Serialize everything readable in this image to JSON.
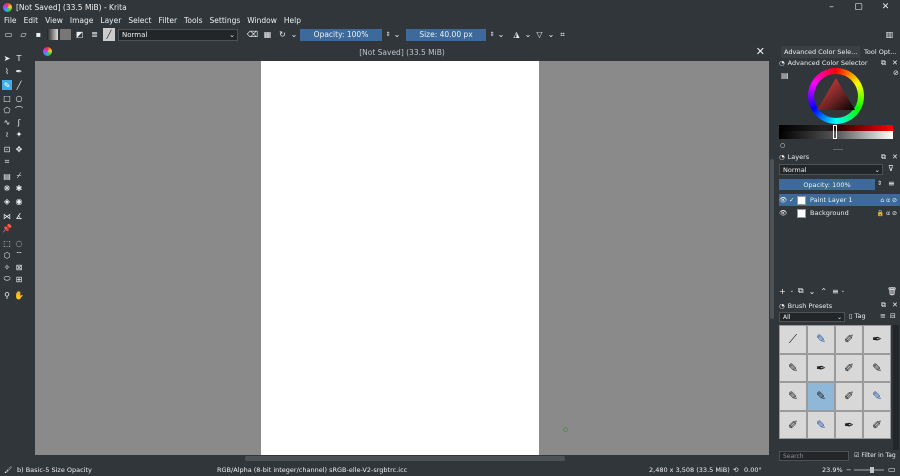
{
  "window": {
    "title": "[Not Saved]  (33.5 MiB)  - Krita",
    "minimize": "–",
    "maximize": "▢",
    "close": "✕"
  },
  "menu": [
    "File",
    "Edit",
    "View",
    "Image",
    "Layer",
    "Select",
    "Filter",
    "Tools",
    "Settings",
    "Window",
    "Help"
  ],
  "toolbar": {
    "blend_mode": "Normal",
    "opacity": "Opacity: 100%",
    "size": "Size: 40.00 px"
  },
  "canvas": {
    "tab_title": "[Not Saved]  (33.5 MiB)",
    "close": "✕"
  },
  "dock": {
    "tabs": [
      "Advanced Color Sele...",
      "Tool Opt..."
    ],
    "color_selector_title": "Advanced Color Selector",
    "layers_title": "Layers",
    "layers_mode": "Normal",
    "layers_opacity": "Opacity:  100%",
    "layers": [
      {
        "name": "Paint Layer 1"
      },
      {
        "name": "Background"
      }
    ],
    "brush_presets_title": "Brush Presets",
    "brush_filter": "All",
    "brush_tag": "Tag",
    "search_placeholder": "Search",
    "filter_in_tag": "Filter in Tag"
  },
  "status": {
    "brush": "b) Basic-5 Size Opacity",
    "color_space": "RGB/Alpha (8-bit integer/channel)  sRGB-elle-V2-srgbtrc.icc",
    "dimensions": "2,480 x 3,508 (33.5 MiB)",
    "rotation": "0.00°",
    "zoom": "23.9%"
  },
  "colors": {
    "accent": "#3daee9",
    "bg": "#31363b",
    "canvas_bg": "#8a8a8a"
  }
}
